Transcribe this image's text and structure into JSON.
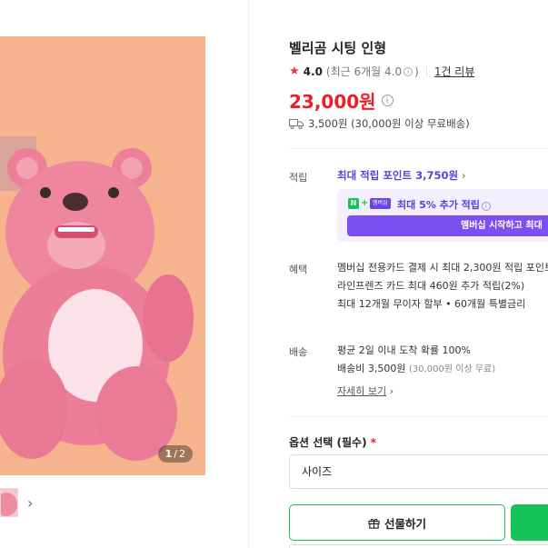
{
  "product": {
    "title": "벨리곰 시팅 인형",
    "rating": "4.0",
    "recent_rating": "(최근 6개월 4.0",
    "recent_rating_close": ")",
    "reviews": "1건 리뷰",
    "price": "23,000원",
    "shipping": "3,500원 (30,000원 이상 무료배송)"
  },
  "gallery": {
    "current_page": "1",
    "slash": "/",
    "total_pages": "2"
  },
  "points": {
    "label": "적립",
    "max_points": "최대 적립 포인트 3,750원",
    "member_badge": "멤버십",
    "member_text": "최대 5% 추가 적립",
    "start_button": "멤버십 시작하고 최대"
  },
  "benefits": {
    "label": "혜택",
    "lines": [
      "멤버십 전용카드 결제 시 최대 2,300원 적립 포인트 받",
      "라인프렌즈 카드 최대 460원 추가 적립(2%)",
      "최대 12개월 무이자 할부 • 60개월 특별금리"
    ]
  },
  "delivery": {
    "label": "배송",
    "line1": "평균 2일 이내 도착 확률 100%",
    "line2_main": "배송비 3,500원",
    "line2_note": "(30,000원 이상 무료)",
    "more": "자세히 보기"
  },
  "options": {
    "label": "옵션 선택 (필수)",
    "required_mark": "*",
    "select_value": "사이즈"
  },
  "actions": {
    "gift_label": "선물하기"
  },
  "colors": {
    "accent_green": "#16c35a",
    "price_red": "#e8202a",
    "member_purple": "#7b4ff0",
    "product_bg": "#f5b48d"
  }
}
